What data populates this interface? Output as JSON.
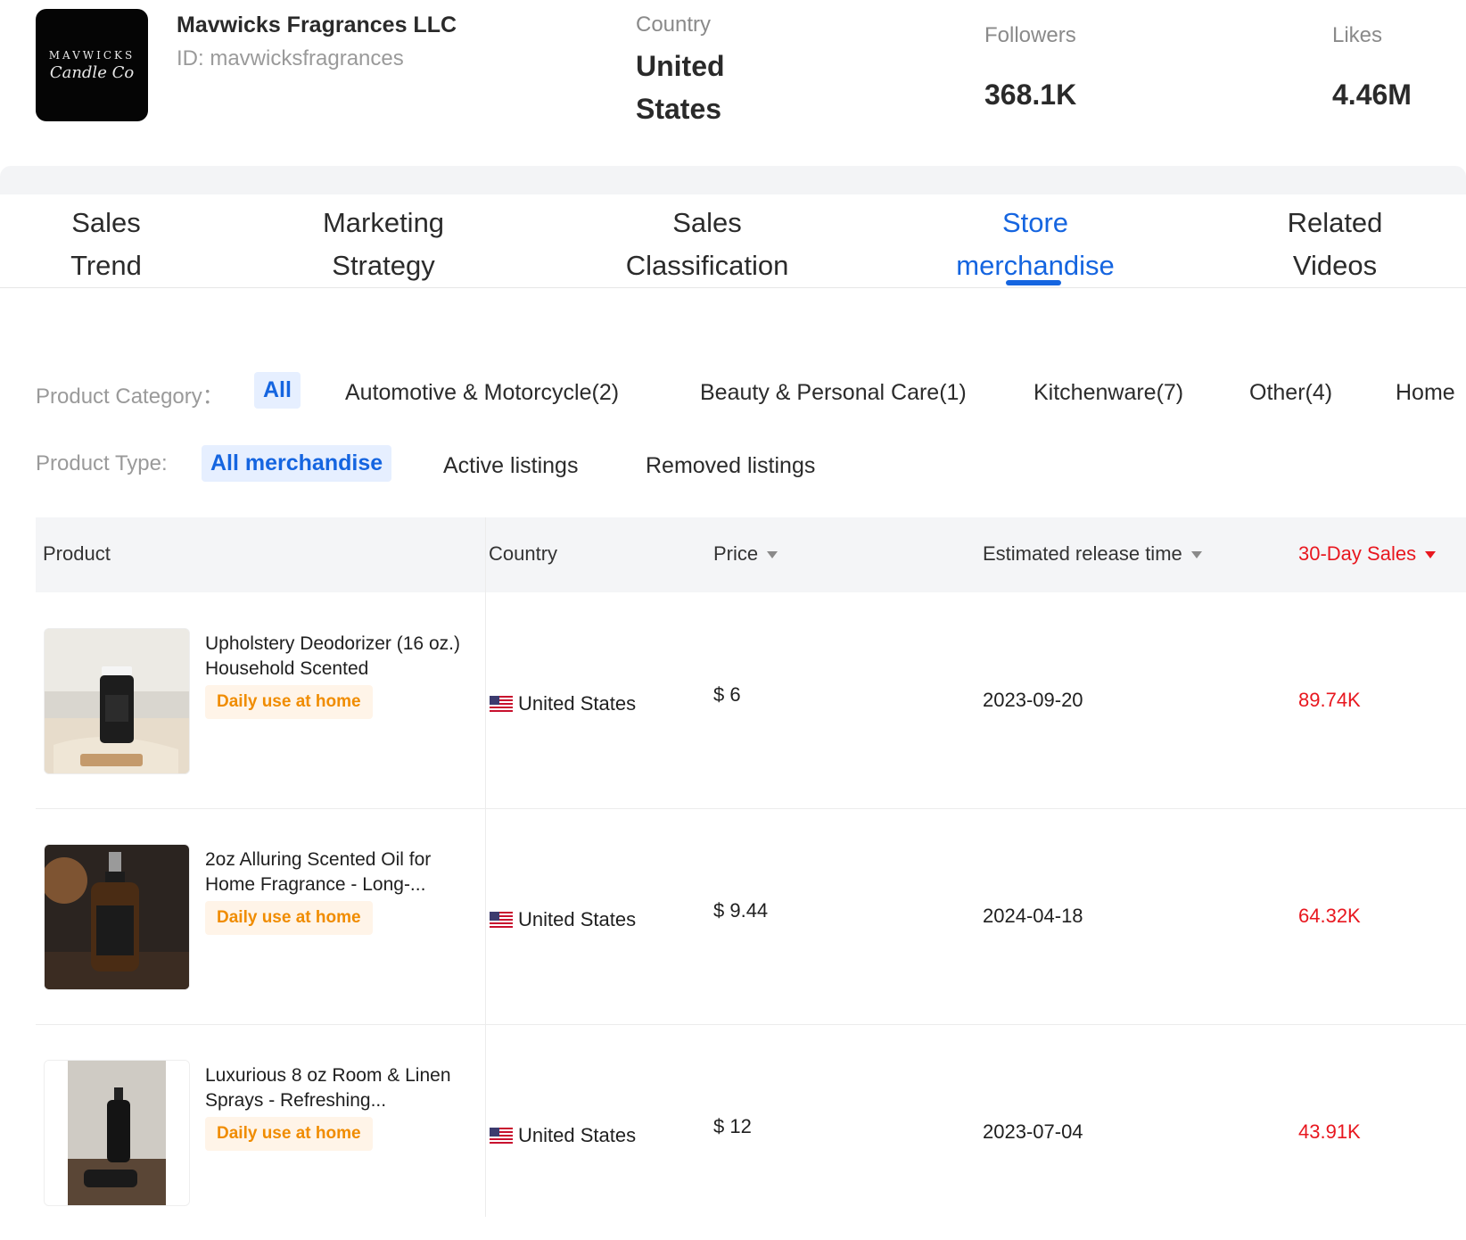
{
  "store": {
    "logo_text_line1": "MAVWICKS",
    "logo_text_line2": "Candle Co",
    "name": "Mavwicks Fragrances LLC",
    "id": "ID: mavwicksfragrances",
    "country_label": "Country",
    "country_value": "United States",
    "followers_label": "Followers",
    "followers_value": "368.1K",
    "likes_label": "Likes",
    "likes_value": "4.46M"
  },
  "tabs": [
    {
      "label": "Sales Trend"
    },
    {
      "label": "Marketing Strategy"
    },
    {
      "label": "Sales Classification"
    },
    {
      "label": "Store merchandise",
      "active": true
    },
    {
      "label": "Related Videos"
    }
  ],
  "filters": {
    "category_label": "Product Category：",
    "categories": [
      "All",
      "Automotive & Motorcycle(2)",
      "Beauty & Personal Care(1)",
      "Kitchenware(7)",
      "Other(4)",
      "Home"
    ],
    "type_label": "Product Type:",
    "types": [
      "All merchandise",
      "Active listings",
      "Removed listings"
    ]
  },
  "table": {
    "headers": {
      "product": "Product",
      "country": "Country",
      "price": "Price",
      "release": "Estimated release time",
      "sales": "30-Day Sales"
    },
    "rows": [
      {
        "name": "Upholstery Deodorizer (16 oz.) Household Scented",
        "tag": "Daily use at home",
        "country": "United States",
        "price": "$ 6",
        "release": "2023-09-20",
        "sales": "89.74K"
      },
      {
        "name": "2oz Alluring Scented Oil for Home Fragrance - Long-...",
        "tag": "Daily use at home",
        "country": "United States",
        "price": "$ 9.44",
        "release": "2024-04-18",
        "sales": "64.32K"
      },
      {
        "name": "Luxurious 8 oz Room & Linen Sprays - Refreshing...",
        "tag": "Daily use at home",
        "country": "United States",
        "price": "$ 12",
        "release": "2023-07-04",
        "sales": "43.91K"
      }
    ]
  },
  "colors": {
    "accent": "#1565e0",
    "sales_red": "#e8171f",
    "tag_orange": "#f08c00"
  }
}
